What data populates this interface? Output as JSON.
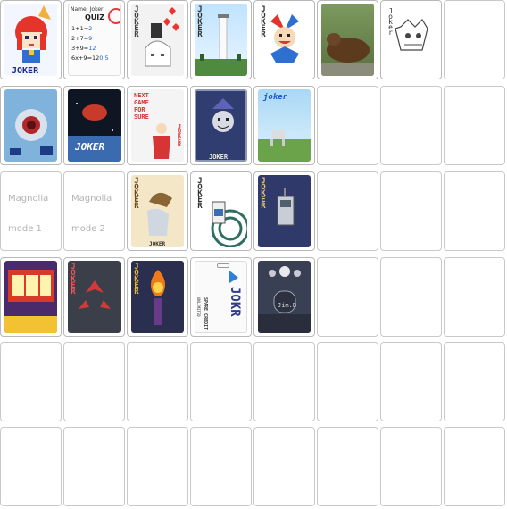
{
  "grid": {
    "columns": 8,
    "rows": 6
  },
  "cards": {
    "r1c1": {
      "title": "JOKER"
    },
    "r1c2": {
      "name_label": "Name: Joker",
      "quiz": "QUIZ",
      "lines": [
        "1+1=",
        "2+7=",
        "3+9=",
        "6x+9=12"
      ],
      "answers": [
        "2",
        "9",
        "12",
        "0.5"
      ]
    },
    "r1c3": {
      "title": "JOKER"
    },
    "r1c4": {
      "title": "JOKER"
    },
    "r1c5": {
      "title": "JOKER"
    },
    "r1c7": {
      "title": "Joker"
    },
    "r2c2": {
      "title": "JOKER"
    },
    "r2c3": {
      "lines": [
        "NEXT",
        "GAME",
        "FOR",
        "SURE"
      ],
      "side": "JOKER"
    },
    "r2c4": {
      "title": "JOKER"
    },
    "r2c5": {
      "title": "joker"
    },
    "r3c1": {
      "line1": "Magnolia",
      "line2": "mode 1"
    },
    "r3c2": {
      "line1": "Magnolia",
      "line2": "mode 2"
    },
    "r3c3": {
      "title": "JOKER",
      "bottom": "JOKER"
    },
    "r3c4": {
      "title": "JOKER"
    },
    "r3c5": {
      "title": "JOKER"
    },
    "r4c2": {
      "title": "JOKER"
    },
    "r4c3": {
      "title": "JOKER"
    },
    "r4c4": {
      "brand": "JOKR",
      "sub": "SPARE CREDIT",
      "sub2": "UNLIMITED"
    },
    "r4c5": {
      "sign": "Jim.B"
    }
  }
}
